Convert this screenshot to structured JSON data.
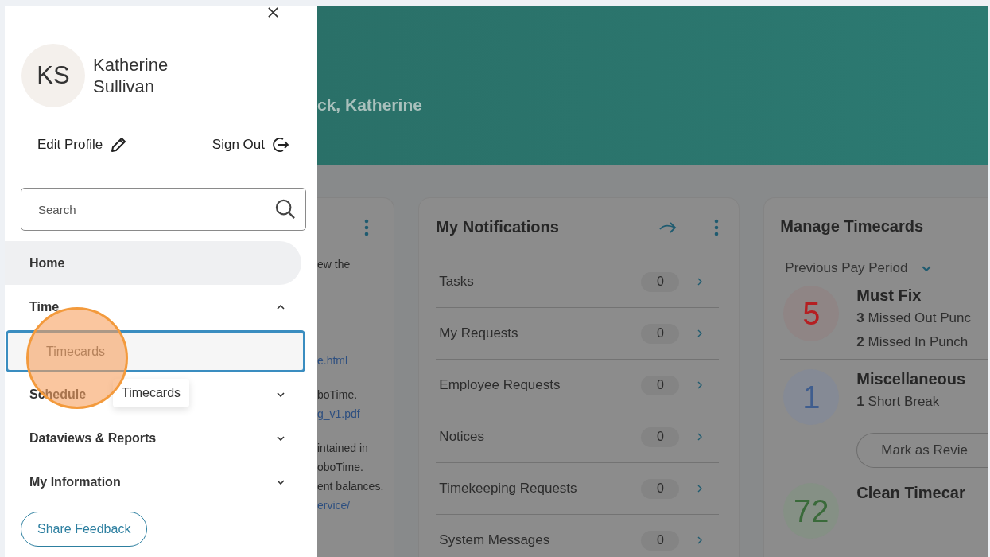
{
  "drawer": {
    "user": {
      "initials": "KS",
      "name": "Katherine Sullivan"
    },
    "actions": [
      {
        "label": "Edit Profile",
        "kind": "edit"
      },
      {
        "label": "Sign Out",
        "kind": "signout"
      }
    ],
    "search": {
      "placeholder": "Search"
    },
    "menu": [
      {
        "label": "Home",
        "kind": "link",
        "selected": true
      },
      {
        "label": "Time",
        "kind": "group",
        "selected": false,
        "expanded": true,
        "children": [
          {
            "label": "Timecards",
            "selected": false,
            "focused": true
          }
        ]
      },
      {
        "label": "Schedule",
        "kind": "group",
        "selected": false,
        "expanded": false
      },
      {
        "label": "Dataviews & Reports",
        "kind": "group",
        "selected": false,
        "expanded": false
      },
      {
        "label": "My Information",
        "kind": "group",
        "selected": false,
        "expanded": false
      }
    ],
    "tooltip": "Timecards",
    "feedback_button": "Share Feedback"
  },
  "header": {
    "greeting": "ck, Katherine"
  },
  "left_card": {
    "paragraphs": [
      [
        {
          "text": "ew the",
          "kind": "text"
        }
      ],
      [
        {
          "text": "e.html",
          "kind": "link"
        }
      ],
      [
        {
          "text": "boTime.",
          "kind": "text"
        },
        {
          "text": "g_v1.pdf",
          "kind": "link"
        }
      ],
      [
        {
          "text": "intained in",
          "kind": "text"
        },
        {
          "text": "oboTime.",
          "kind": "text"
        },
        {
          "text": "ent balances.",
          "kind": "text"
        },
        {
          "text": "ervice/",
          "kind": "link"
        }
      ]
    ]
  },
  "notifications": {
    "title": "My Notifications",
    "rows": [
      {
        "label": "Tasks",
        "count": "0"
      },
      {
        "label": "My Requests",
        "count": "0"
      },
      {
        "label": "Employee Requests",
        "count": "0"
      },
      {
        "label": "Notices",
        "count": "0"
      },
      {
        "label": "Timekeeping Requests",
        "count": "0"
      },
      {
        "label": "System Messages",
        "count": "0"
      }
    ]
  },
  "timecards": {
    "title": "Manage Timecards",
    "period": "Previous Pay Period",
    "groups": [
      {
        "kind": "must_fix",
        "count": "5",
        "title": "Must Fix",
        "items": [
          {
            "count": "3",
            "label": "Missed Out Punc"
          },
          {
            "count": "2",
            "label": "Missed In Punch"
          }
        ]
      },
      {
        "kind": "misc",
        "count": "1",
        "title": "Miscellaneous",
        "items": [
          {
            "count": "1",
            "label": "Short Break"
          }
        ],
        "button": "Mark as Revie"
      },
      {
        "kind": "clean",
        "count": "72",
        "title": "Clean Timecar"
      }
    ]
  }
}
